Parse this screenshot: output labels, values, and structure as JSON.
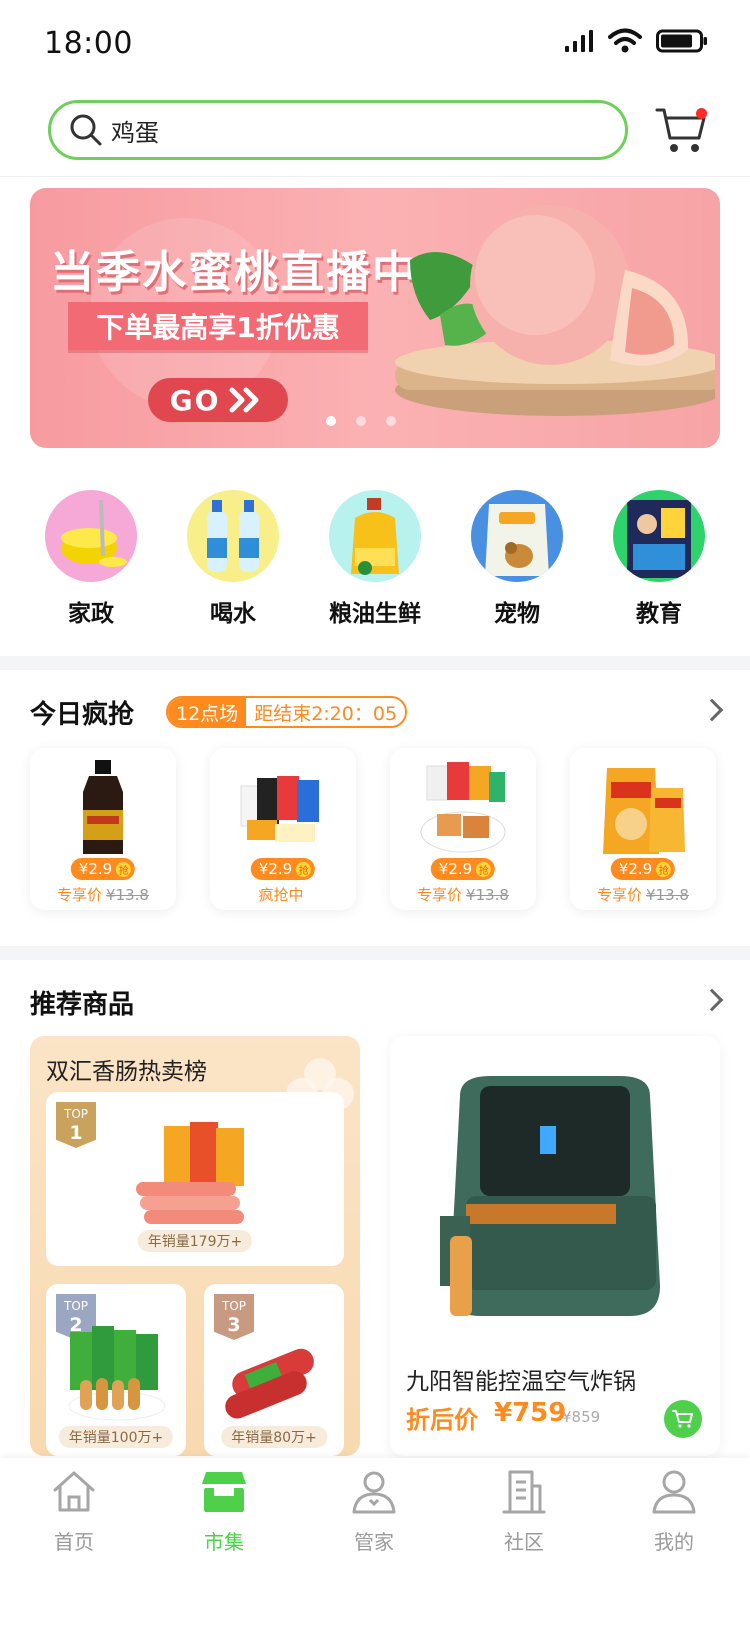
{
  "status_bar": {
    "time": "18:00"
  },
  "search": {
    "value": "鸡蛋"
  },
  "banner": {
    "title": "当季水蜜桃直播中",
    "subtitle": "下单最高享1折优惠",
    "button": "GO",
    "slides": 3,
    "active_slide": 0
  },
  "categories": [
    {
      "label": "家政",
      "icon": "mop-bucket-icon",
      "bg": "#f6a9d6"
    },
    {
      "label": "喝水",
      "icon": "water-bottles-icon",
      "bg": "#f8ef8a"
    },
    {
      "label": "粮油生鲜",
      "icon": "cooking-oil-icon",
      "bg": "#b7f2ee"
    },
    {
      "label": "宠物",
      "icon": "pet-food-icon",
      "bg": "#4a90e2"
    },
    {
      "label": "教育",
      "icon": "education-book-icon",
      "bg": "#2fd36b"
    }
  ],
  "flash_sale": {
    "title": "今日疯抢",
    "session": "12点场",
    "countdown": "距结束2:20：05",
    "items": [
      {
        "name": "soy-sauce",
        "price": "¥2.9",
        "badge": "抢",
        "tag": "专享价",
        "original": "¥13.8"
      },
      {
        "name": "snack-bundle",
        "price": "¥2.9",
        "badge": "抢",
        "tag": "疯抢中",
        "original": ""
      },
      {
        "name": "spicy-tofu",
        "price": "¥2.9",
        "badge": "抢",
        "tag": "专享价",
        "original": "¥13.8"
      },
      {
        "name": "chips",
        "price": "¥2.9",
        "badge": "抢",
        "tag": "专享价",
        "original": "¥13.8"
      }
    ]
  },
  "recommended": {
    "title": "推荐商品",
    "ranking": {
      "title": "双汇香肠热卖榜",
      "items": [
        {
          "rank_label": "TOP",
          "rank": "1",
          "sales": "年销量179万+"
        },
        {
          "rank_label": "TOP",
          "rank": "2",
          "sales": "年销量100万+"
        },
        {
          "rank_label": "TOP",
          "rank": "3",
          "sales": "年销量80万+"
        }
      ]
    },
    "product": {
      "name": "九阳智能控温空气炸锅",
      "price_label": "折后价",
      "price": "¥759",
      "original_price": "¥859"
    }
  },
  "tabbar": {
    "active": 1,
    "tabs": [
      {
        "label": "首页",
        "icon": "home-icon"
      },
      {
        "label": "市集",
        "icon": "market-icon"
      },
      {
        "label": "管家",
        "icon": "butler-icon"
      },
      {
        "label": "社区",
        "icon": "community-icon"
      },
      {
        "label": "我的",
        "icon": "profile-icon"
      }
    ]
  },
  "colors": {
    "accent_green": "#4fd04b",
    "accent_orange": "#ff8a1e",
    "banner_pink": "#f79ba0"
  }
}
